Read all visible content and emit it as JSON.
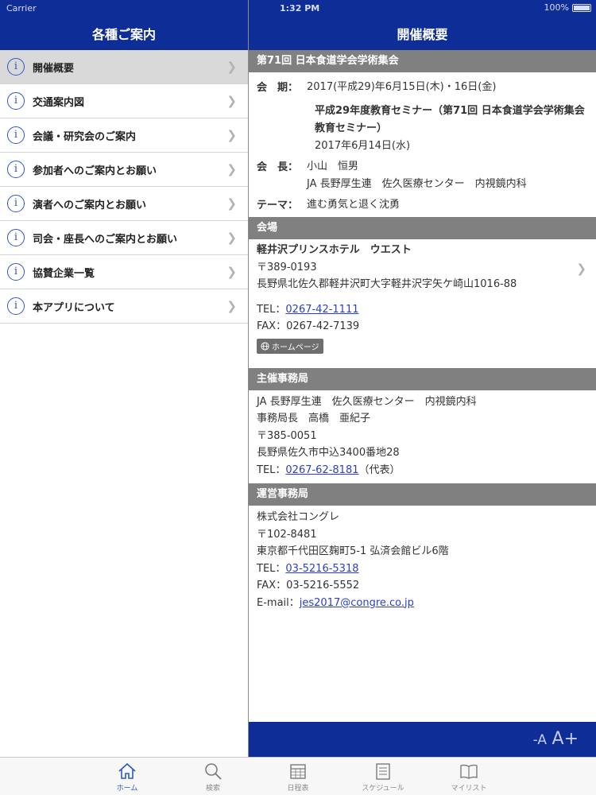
{
  "status": {
    "carrier": "Carrier",
    "time": "1:32 PM",
    "battery": "100%"
  },
  "left_title": "各種ご案内",
  "right_title": "開催概要",
  "menu": [
    {
      "label": "開催概要",
      "active": true
    },
    {
      "label": "交通案内図"
    },
    {
      "label": "会議・研究会のご案内"
    },
    {
      "label": "参加者へのご案内とお願い"
    },
    {
      "label": "演者へのご案内とお願い"
    },
    {
      "label": "司会・座長へのご案内とお願い"
    },
    {
      "label": "協賛企業一覧"
    },
    {
      "label": "本アプリについて"
    }
  ],
  "overview": {
    "section_title": "第71回 日本食道学会学術集会",
    "period_label": "会　期：",
    "period_value": "2017(平成29)年6月15日(木)・16日(金)",
    "seminar_title_1": "平成29年度教育セミナー（第71回 日本食道学会学術集会",
    "seminar_title_2": "教育セミナー）",
    "seminar_date": "2017年6月14日(水)",
    "president_label": "会　長：",
    "president_name": "小山　恒男",
    "president_affil": "JA 長野厚生連　佐久医療センター　内視鏡内科",
    "theme_label": "テーマ：",
    "theme_value": "進む勇気と退く沈勇"
  },
  "venue": {
    "section_title": "会場",
    "name": "軽井沢プリンスホテル　ウエスト",
    "postal": "〒389-0193",
    "address": "長野県北佐久郡軽井沢町大字軽井沢字矢ケ崎山1016-88",
    "tel_label": "TEL：",
    "tel": "0267-42-1111",
    "fax": "FAX：0267-42-7139",
    "homepage_button": "ホームページ"
  },
  "organizer": {
    "section_title": "主催事務局",
    "line1": "JA 長野厚生連　佐久医療センター　内視鏡内科",
    "line2": "事務局長　高橋　亜紀子",
    "postal": "〒385-0051",
    "address": "長野県佐久市中込3400番地28",
    "tel_label": "TEL：",
    "tel": "0267-62-8181",
    "tel_note": "（代表）"
  },
  "management": {
    "section_title": "運営事務局",
    "company": "株式会社コングレ",
    "postal": "〒102-8481",
    "address": "東京都千代田区麹町5-1 弘済会館ビル6階",
    "tel_label": "TEL：",
    "tel": "03-5216-5318",
    "fax": "FAX：03-5216-5552",
    "email_label": "E-mail：",
    "email": "jes2017@congre.co.jp"
  },
  "font_controls": {
    "smaller": "-A",
    "larger": "A+"
  },
  "tabs": [
    {
      "label": "ホーム",
      "icon": "home-icon",
      "active": true
    },
    {
      "label": "検索",
      "icon": "search-icon"
    },
    {
      "label": "日程表",
      "icon": "calendar-icon"
    },
    {
      "label": "スケジュール",
      "icon": "schedule-icon"
    },
    {
      "label": "マイリスト",
      "icon": "book-icon"
    }
  ],
  "colors": {
    "header": "#0e2d97",
    "section_header": "#808080",
    "link": "#2b3fc8",
    "active_tab": "#2e56c8"
  }
}
